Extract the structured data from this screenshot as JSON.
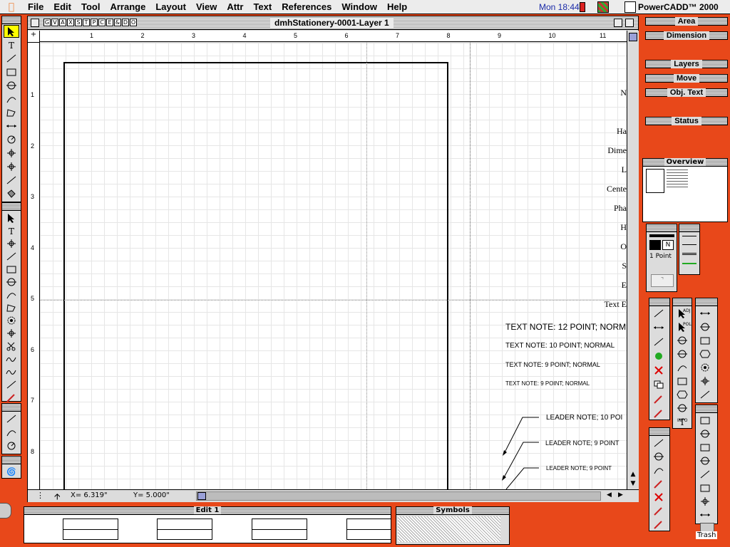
{
  "menubar": {
    "items": [
      "File",
      "Edit",
      "Tool",
      "Arrange",
      "Layout",
      "View",
      "Attr",
      "Text",
      "References",
      "Window",
      "Help"
    ],
    "clock": "Mon 18:44",
    "app_name": "PowerCADD™ 2000"
  },
  "window": {
    "title": "dmhStationery-0001-Layer 1",
    "tab_letters": [
      "G",
      "V",
      "A",
      "X",
      "S",
      "T",
      "P",
      "C",
      "E",
      "&",
      "D",
      "O"
    ],
    "ruler_h": [
      "1",
      "2",
      "3",
      "4",
      "5",
      "6",
      "7",
      "8",
      "9",
      "10",
      "11"
    ],
    "ruler_v": [
      "1",
      "2",
      "3",
      "4",
      "5",
      "6",
      "7",
      "8"
    ],
    "status": {
      "x": "X= 6.319\"",
      "y": "Y= 5.000\""
    }
  },
  "drawing": {
    "labels": [
      "N",
      "Ha",
      "Dime",
      "L",
      "Cente",
      "Pha",
      "H",
      "O",
      "S",
      "E",
      "Text E"
    ],
    "text_notes": [
      "TEXT NOTE: 12 POINT; NORM",
      "TEXT NOTE: 10 POINT; NORMAL",
      "TEXT NOTE: 9 POINT; NORMAL",
      "TEXT NOTE: 9 POINT; NORMAL"
    ],
    "leader_notes": [
      "LEADER NOTE; 10 POI",
      "LEADER NOTE; 9 POINT",
      "LEADER NOTE; 9 POINT"
    ]
  },
  "palettes": {
    "right": [
      "Area",
      "Dimension",
      "Layers",
      "Move",
      "Obj. Text",
      "Status"
    ],
    "overview": "Overview",
    "line_weight": "1 Point",
    "line_n": "N",
    "edit": "Edit 1",
    "symbols": "Symbols",
    "trash": "Trash",
    "adj": "ADJ",
    "pol": "POL",
    "info": "INFO"
  },
  "colors": {
    "desktop": "#e8481a",
    "menu_clock": "#1a2aa8",
    "accent_tool": "#ffff00"
  }
}
